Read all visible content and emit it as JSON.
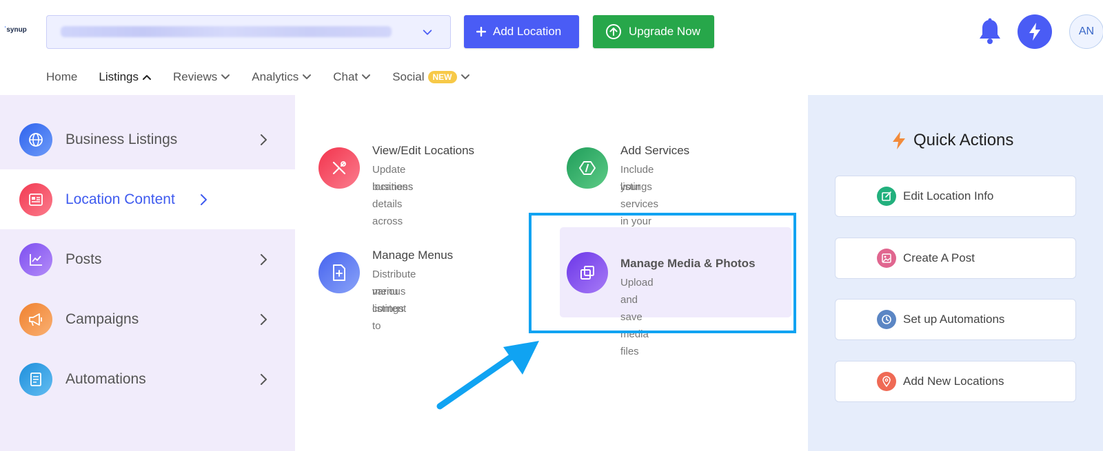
{
  "logo": {
    "text": "synup"
  },
  "header": {
    "add_location_label": "Add Location",
    "upgrade_label": "Upgrade Now",
    "avatar_initials": "AN"
  },
  "nav": {
    "items": [
      {
        "label": "Home"
      },
      {
        "label": "Listings"
      },
      {
        "label": "Reviews"
      },
      {
        "label": "Analytics"
      },
      {
        "label": "Chat"
      },
      {
        "label": "Social"
      }
    ],
    "new_badge": "NEW"
  },
  "sidebar": {
    "items": [
      {
        "label": "Business Listings",
        "icon": "globe-icon",
        "color": "#3a6df0"
      },
      {
        "label": "Location Content",
        "icon": "newspaper-icon",
        "color": "#f1415b"
      },
      {
        "label": "Posts",
        "icon": "chart-line-icon",
        "color": "#8b5cf6"
      },
      {
        "label": "Campaigns",
        "icon": "megaphone-icon",
        "color": "#f28b3b"
      },
      {
        "label": "Automations",
        "icon": "document-icon",
        "color": "#2a9ae0"
      }
    ]
  },
  "content": {
    "cards": [
      {
        "title": "View/Edit Locations",
        "desc1": "Update business details across",
        "desc2": "locations",
        "icon": "tools-icon"
      },
      {
        "title": "Add Services",
        "desc1": "Include your services in your",
        "desc2": "listings",
        "icon": "hexagon-icon"
      },
      {
        "title": "Manage Menus",
        "desc1": "Distribute menu content to",
        "desc2": "various listings",
        "icon": "add-file-icon"
      },
      {
        "title": "Manage Media & Photos",
        "desc1": "Upload and save media files",
        "desc2": "",
        "icon": "copy-icon"
      }
    ]
  },
  "quick_actions": {
    "title": "Quick Actions",
    "items": [
      {
        "label": "Edit Location Info",
        "icon": "edit-icon",
        "color": "#22b07d"
      },
      {
        "label": "Create A Post",
        "icon": "image-icon",
        "color": "#e0668f"
      },
      {
        "label": "Set up Automations",
        "icon": "clock-icon",
        "color": "#5b86c4"
      },
      {
        "label": "Add New Locations",
        "icon": "pin-icon",
        "color": "#ef6a55"
      }
    ]
  },
  "colors": {
    "accent": "#4a5cf5",
    "upgrade": "#27a74a",
    "highlight": "#10a3f2"
  }
}
